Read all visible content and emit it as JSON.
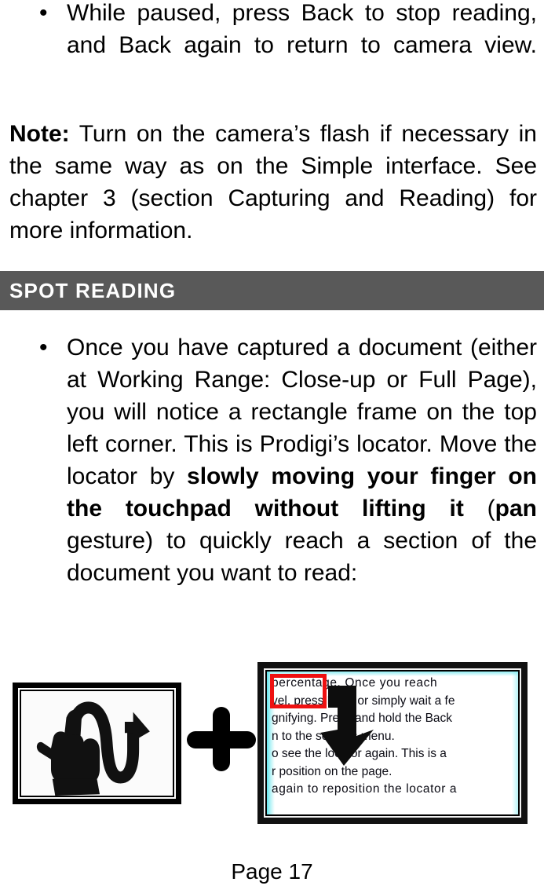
{
  "document": {
    "page_label": "Page 17"
  },
  "top_bullets": [
    {
      "marker": "•",
      "text": "While paused, press Back to stop reading, and Back again to return to camera view."
    }
  ],
  "note_paragraph": {
    "label": "Note:",
    "text": " Turn on the camera’s flash if necessary in the same way as on the Simple interface. See chapter 3 (section Capturing and Reading) for more information."
  },
  "section": {
    "title": "SPOT READING",
    "band_color": "#595959",
    "text_color": "#ffffff"
  },
  "spot_reading_bullet": {
    "marker": "•",
    "part1": "Once you have captured a document (either at Working Range: Close-up or Full Page), you will notice a rectangle frame on the top left corner. This is Prodigi’s locator. Move the locator by ",
    "bold1": "slowly moving your finger on the touchpad without lifting it",
    "mid": " (",
    "bold2": "pan",
    "part2": " gesture) to quickly reach a section of the document you want to read:"
  },
  "figures": {
    "gesture_image": {
      "name": "pan-gesture-illustration",
      "description": "hand with extended index finger tracing a wavy path ending in an arrow"
    },
    "plus_symbol": "+",
    "device_screenshot": {
      "name": "prodigi-locator-screenshot",
      "locator_color": "#ee1111",
      "lines": [
        "percentage.  Once  you  reach",
        "vel. press Back or simply wait a fe",
        "gnifying. Press and hold the Back",
        "n to the settings menu.",
        "o see the locator again. This is a",
        "r position on the page.",
        "again  to  reposition  the  locator  a"
      ]
    }
  }
}
